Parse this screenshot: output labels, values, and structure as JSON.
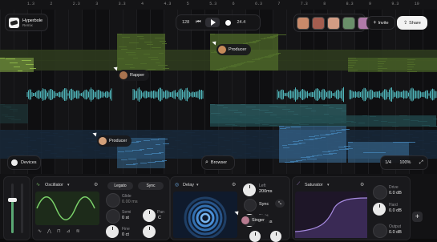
{
  "ruler": {
    "ticks": [
      "1.3",
      "2",
      "2.3",
      "3",
      "3.3",
      "4",
      "4.3",
      "5",
      "5.3",
      "6",
      "6.3",
      "7",
      "7.3",
      "8",
      "8.3",
      "9",
      "9.3",
      "10"
    ]
  },
  "project": {
    "name": "Hyperbole",
    "subtitle": "Remix"
  },
  "transport": {
    "bpm": "128",
    "time": "24.4"
  },
  "collab": {
    "invite_label": "Invite",
    "share_label": "Share"
  },
  "cursors": {
    "producer": "Producer",
    "rapper": "Rapper",
    "producer2": "Producer",
    "singer": "Singer"
  },
  "toolbar": {
    "devices_label": "Devices",
    "browser_label": "Browser",
    "quantize": "1/4",
    "zoom": "100%"
  },
  "oscillator": {
    "title": "Oscillator",
    "legato_label": "Legato",
    "sync_label": "Sync",
    "glide_label": "Glide",
    "glide_value": "0.00 ms",
    "semi_label": "Semi",
    "semi_value": "0 st",
    "fine_label": "Fine",
    "fine_value": "0 ct",
    "pan_label": "Pan",
    "pan_value": "C"
  },
  "delay": {
    "title": "Delay",
    "left_label": "Left",
    "left_value": "200ms",
    "sync_label": "Sync",
    "right_label": "Right",
    "right_value": "200ms"
  },
  "saturator": {
    "title": "Saturator",
    "drive_label": "Drive",
    "drive_value": "0.0 dB",
    "hard_label": "Hard",
    "hard_value": "0.0 dB",
    "output_label": "Output",
    "output_value": "0.0 dB"
  },
  "colors": {
    "green": "#8fb84a",
    "teal": "#4fb3b8",
    "blue": "#3f79a8",
    "accent": "#4a86e8"
  }
}
